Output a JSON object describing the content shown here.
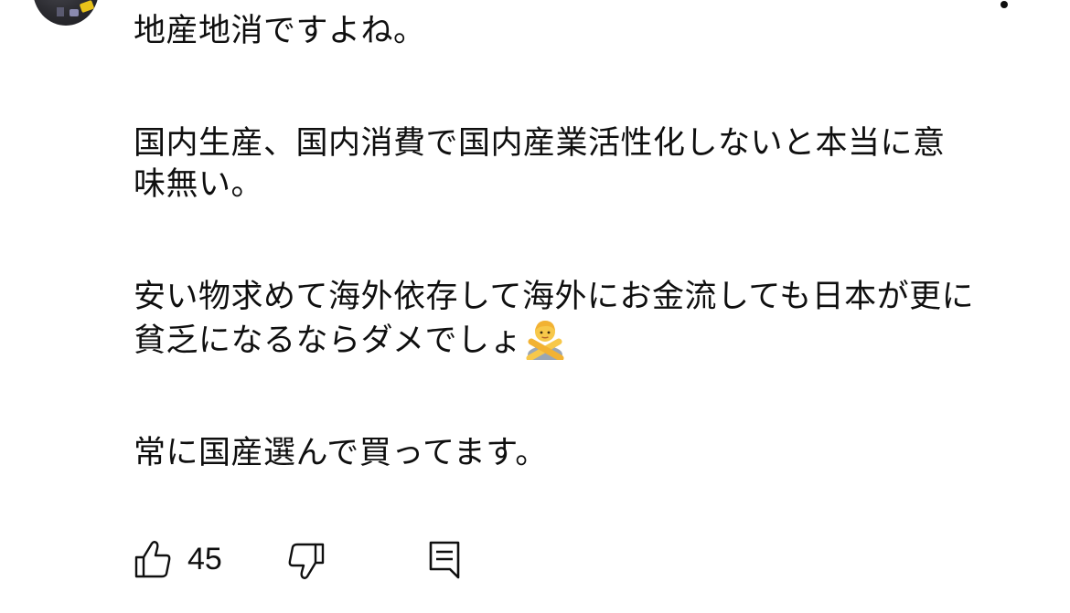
{
  "comment": {
    "paragraphs": [
      "地産地消ですよね。",
      "国内生産、国内消費で国内産業活性化しないと本当に意味無い。",
      "安い物求めて海外依存して海外にお金流しても日本が更に貧乏になるならダメでしょ",
      "常に国産選んで買ってます。"
    ],
    "emoji": "person-gesturing-no"
  },
  "actions": {
    "like_count": "45",
    "like_icon": "thumbs-up-icon",
    "dislike_icon": "thumbs-down-icon",
    "reply_icon": "reply-comment-icon"
  },
  "colors": {
    "text": "#0f0f0f",
    "background": "#ffffff"
  }
}
